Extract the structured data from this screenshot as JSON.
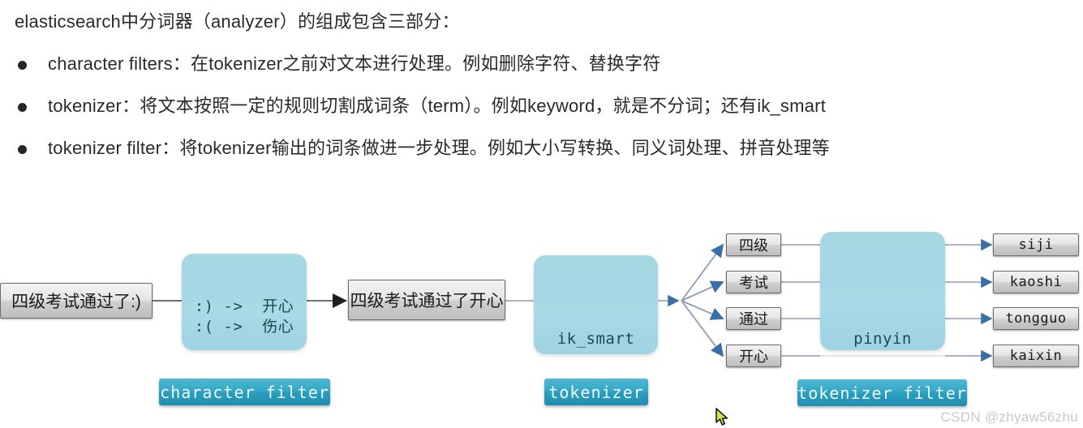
{
  "article": {
    "intro": "elasticsearch中分词器（analyzer）的组成包含三部分：",
    "bullets": [
      "character filters：在tokenizer之前对文本进行处理。例如删除字符、替换字符",
      "tokenizer：将文本按照一定的规则切割成词条（term）。例如keyword，就是不分词；还有ik_smart",
      "tokenizer filter：将tokenizer输出的词条做进一步处理。例如大小写转换、同义词处理、拼音处理等"
    ]
  },
  "diagram": {
    "input_box": "四级考试通过了:)",
    "char_filter_box": {
      "rules": ":) ->  开心\n:( ->  伤心",
      "caption": "character filter"
    },
    "filtered_box": "四级考试通过了开心",
    "tokenizer_box": {
      "name": "ik_smart",
      "caption": "tokenizer"
    },
    "terms": [
      "四级",
      "考试",
      "通过",
      "开心"
    ],
    "token_filter_box": {
      "name": "pinyin",
      "caption": "tokenizer filter"
    },
    "outputs": [
      "siji",
      "kaoshi",
      "tongguo",
      "kaixin"
    ]
  },
  "watermark": "CSDN @zhyaw56zhu",
  "colors": {
    "component_fill": "#a6d8e4",
    "caption_chip": "#2a9dbd",
    "box_fill": "#e6e6e6",
    "arrow": "#8e9bb3",
    "arrow_head": "#3a6ea8",
    "text": "#2a2a2a"
  }
}
